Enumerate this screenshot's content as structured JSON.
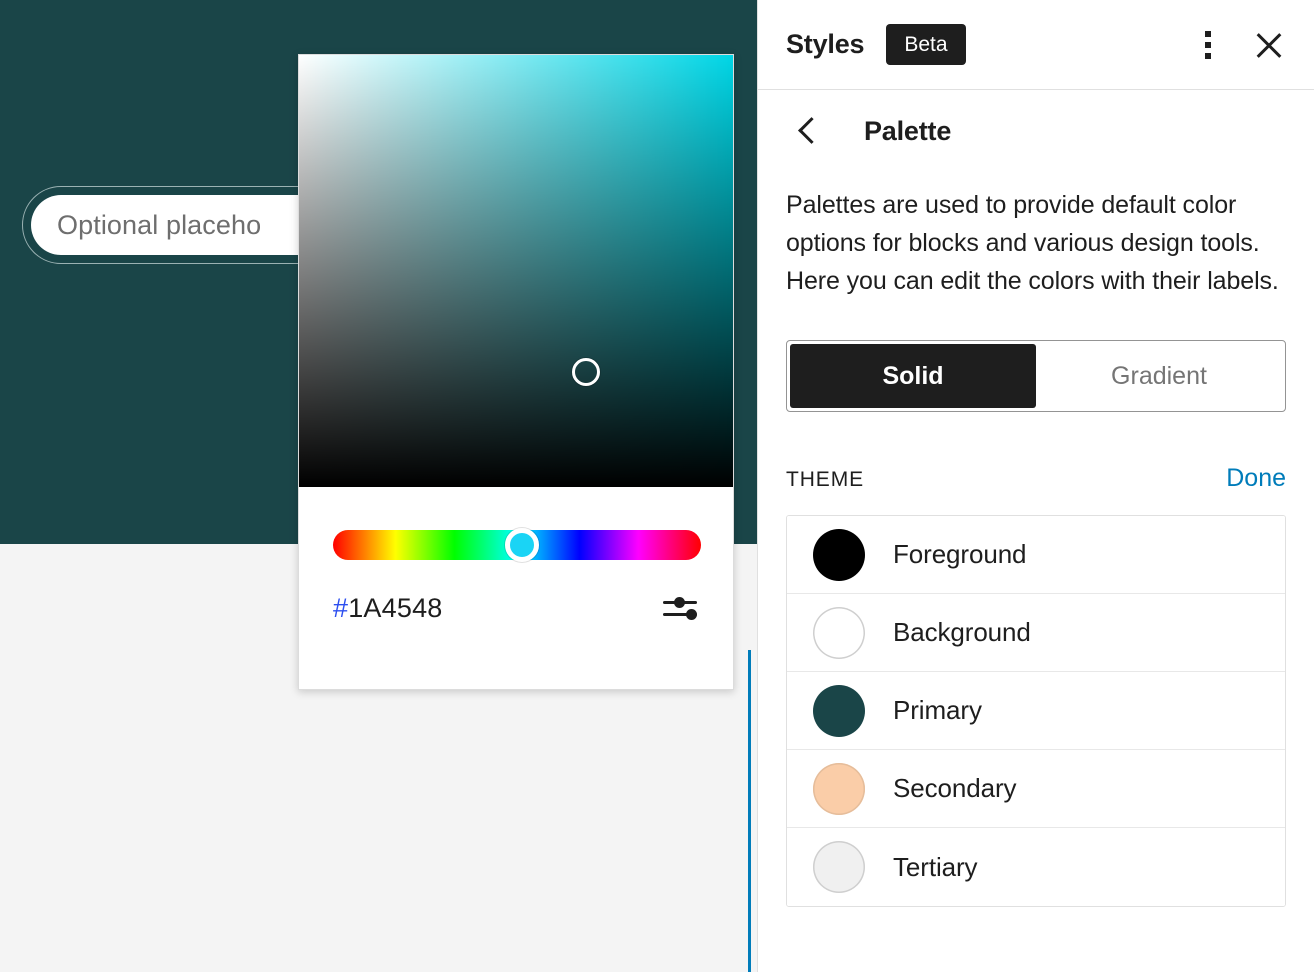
{
  "canvas": {
    "background_color": "#1a4548",
    "lower_background_color": "#f4f4f4",
    "selection_color": "#007cba",
    "search_placeholder": "Optional placeholder…",
    "search_placeholder_visible": "Optional placeho"
  },
  "color_picker": {
    "hex_hash": "#",
    "hex_value": "1A4548",
    "full_hex": "#1A4548",
    "hue_color": "#00d6e6",
    "settings_icon": "sliders-icon",
    "saturation_pointer_label": "saturation-value-pointer",
    "hue_handle_label": "hue-slider-handle"
  },
  "sidebar": {
    "header": {
      "title": "Styles",
      "badge": "Beta",
      "menu_icon": "kebab-menu-icon",
      "close_icon": "close-icon"
    },
    "subnav": {
      "back_icon": "chevron-left-icon",
      "title": "Palette"
    },
    "description": "Palettes are used to provide default color options for blocks and various design tools. Here you can edit the colors with their labels.",
    "segmented_control": {
      "options": [
        {
          "label": "Solid",
          "active": true
        },
        {
          "label": "Gradient",
          "active": false
        }
      ]
    },
    "theme_section": {
      "label": "THEME",
      "action_label": "Done",
      "action_color": "#007cba",
      "swatches": [
        {
          "name": "Foreground",
          "color": "#000000"
        },
        {
          "name": "Background",
          "color": "#ffffff"
        },
        {
          "name": "Primary",
          "color": "#1a4548"
        },
        {
          "name": "Secondary",
          "color": "#facda8"
        },
        {
          "name": "Tertiary",
          "color": "#f0f0f0"
        }
      ]
    }
  }
}
